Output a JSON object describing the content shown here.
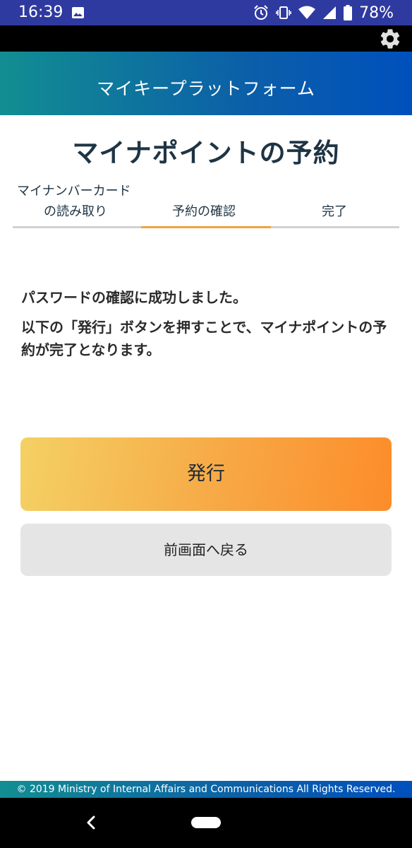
{
  "status_bar": {
    "time": "16:39",
    "battery": "78%",
    "icons": [
      "image-icon",
      "alarm-icon",
      "vibrate-icon",
      "wifi-icon",
      "signal-icon",
      "battery-icon"
    ]
  },
  "topbar": {
    "settings_icon": "gear-icon"
  },
  "header": {
    "title": "マイキープラットフォーム"
  },
  "page": {
    "title": "マイナポイントの予約"
  },
  "steps": {
    "step1_line1": "マイナンバーカード",
    "step1_line2": "の読み取り",
    "step2": "予約の確認",
    "step3": "完了",
    "active_index": 2
  },
  "message": {
    "line1": "パスワードの確認に成功しました。",
    "line2": "以下の「発行」ボタンを押すことで、マイナポイントの予約が完了となります。"
  },
  "buttons": {
    "issue": "発行",
    "back": "前画面へ戻る"
  },
  "footer": {
    "copyright": "© 2019 Ministry of Internal Affairs and Communications All Rights Reserved."
  },
  "colors": {
    "header_start": "#128e92",
    "header_end": "#0050bd",
    "accent_orange": "#f5a23a",
    "title_text": "#1e3444"
  }
}
